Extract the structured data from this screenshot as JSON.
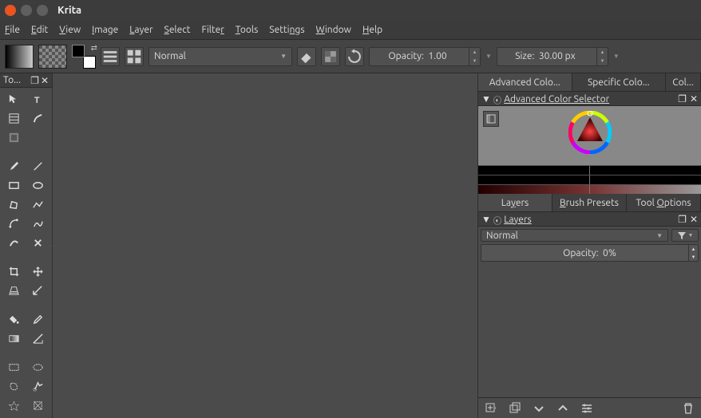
{
  "window": {
    "title": "Krita"
  },
  "menu": {
    "items": [
      "File",
      "Edit",
      "View",
      "Image",
      "Layer",
      "Select",
      "Filter",
      "Tools",
      "Settings",
      "Window",
      "Help"
    ]
  },
  "toolbar": {
    "blend_mode": "Normal",
    "opacity_label": "Opacity:",
    "opacity_value": "1.00",
    "size_label": "Size:",
    "size_value": "30.00 px"
  },
  "toolbox": {
    "title": "To..."
  },
  "right_top_tabs": [
    "Advanced Colo...",
    "Specific Colo...",
    "Col..."
  ],
  "color_selector": {
    "title": "Advanced Color Selector"
  },
  "right_mid_tabs": [
    "Layers",
    "Brush Presets",
    "Tool Options"
  ],
  "layers": {
    "title": "Layers",
    "blend_mode": "Normal",
    "opacity_label": "Opacity:",
    "opacity_value": "0%"
  }
}
